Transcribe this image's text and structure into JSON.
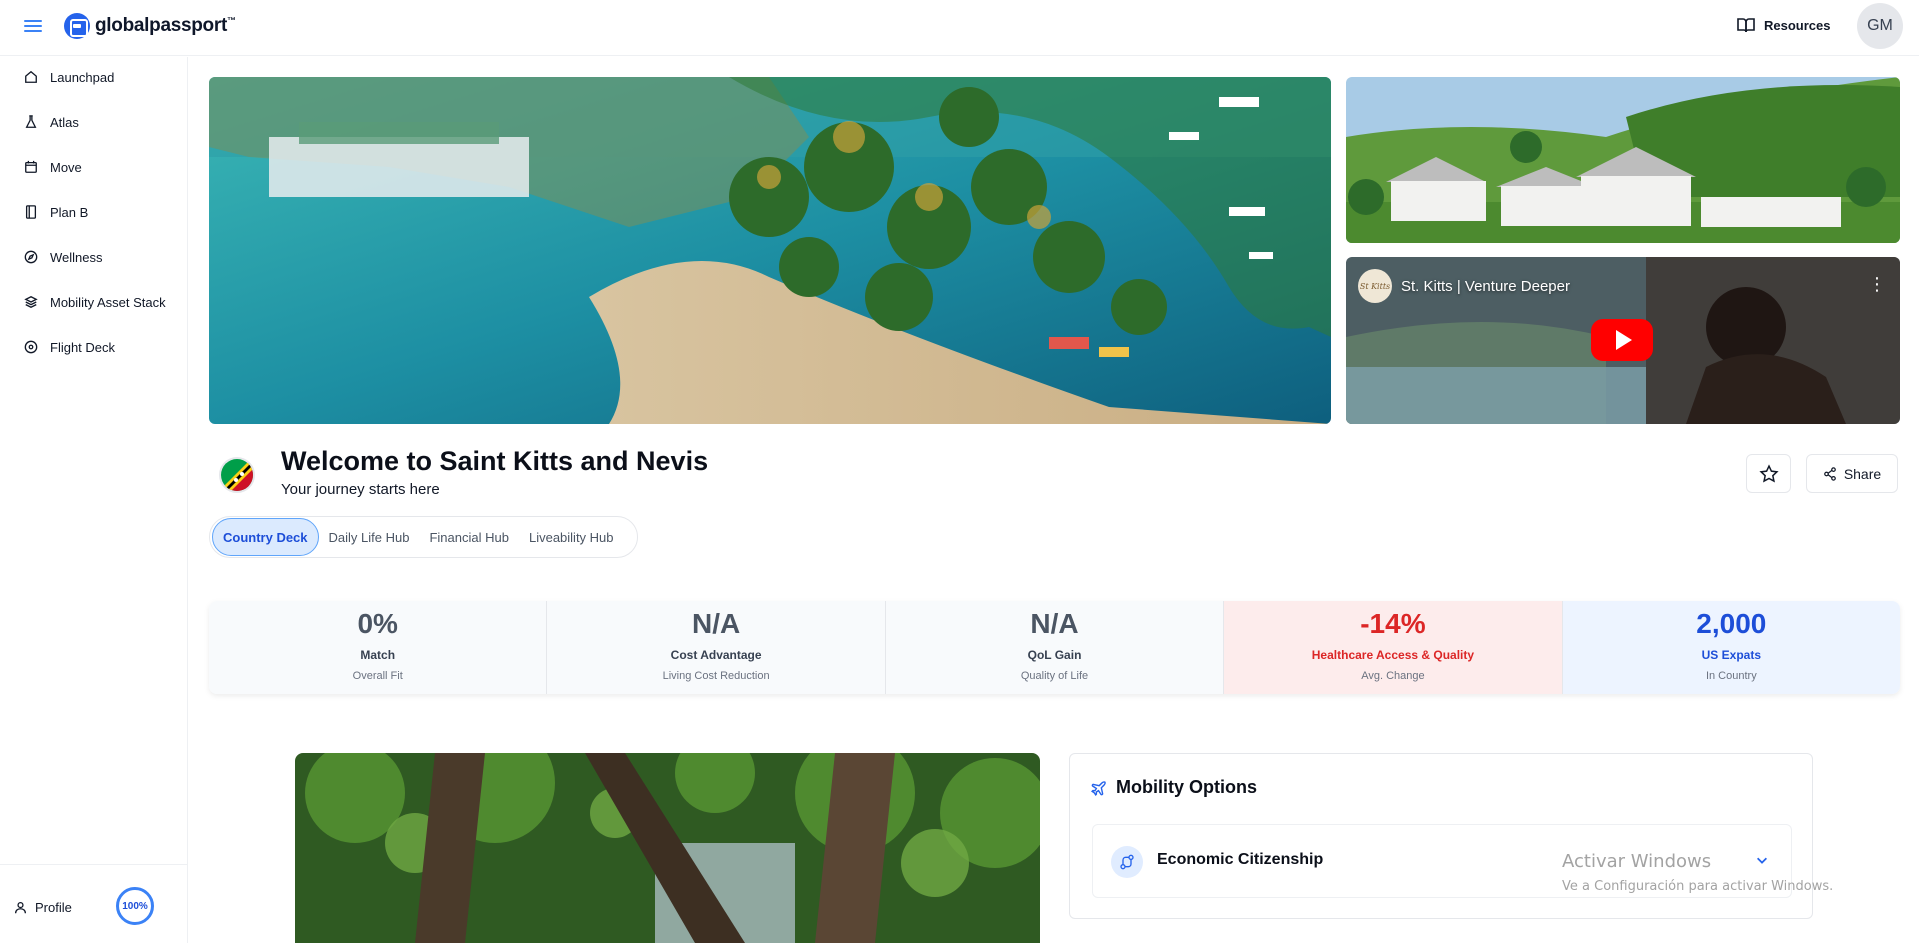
{
  "app": {
    "logo_text": "globalpassport",
    "logo_tm": "™",
    "resources_label": "Resources",
    "avatar_initials": "GM"
  },
  "sidebar": {
    "items": [
      {
        "label": "Launchpad",
        "icon": "home-icon"
      },
      {
        "label": "Atlas",
        "icon": "flask-icon"
      },
      {
        "label": "Move",
        "icon": "calendar-icon"
      },
      {
        "label": "Plan B",
        "icon": "book-icon"
      },
      {
        "label": "Wellness",
        "icon": "compass-icon"
      },
      {
        "label": "Mobility Asset Stack",
        "icon": "layers-icon"
      },
      {
        "label": "Flight Deck",
        "icon": "target-icon"
      }
    ],
    "profile_label": "Profile",
    "profile_completion": "100%"
  },
  "video": {
    "title": "St. Kitts | Venture Deeper",
    "channel_badge": "St Kitts"
  },
  "header": {
    "title": "Welcome to Saint Kitts and Nevis",
    "subtitle": "Your journey starts here",
    "share_label": "Share"
  },
  "tabs": [
    {
      "label": "Country Deck",
      "active": true
    },
    {
      "label": "Daily Life Hub",
      "active": false
    },
    {
      "label": "Financial Hub",
      "active": false
    },
    {
      "label": "Liveability Hub",
      "active": false
    }
  ],
  "stats": [
    {
      "value": "0%",
      "label": "Match",
      "sub": "Overall Fit",
      "tone": "neutral"
    },
    {
      "value": "N/A",
      "label": "Cost Advantage",
      "sub": "Living Cost Reduction",
      "tone": "neutral"
    },
    {
      "value": "N/A",
      "label": "QoL Gain",
      "sub": "Quality of Life",
      "tone": "neutral"
    },
    {
      "value": "-14%",
      "label": "Healthcare Access & Quality",
      "sub": "Avg. Change",
      "tone": "red"
    },
    {
      "value": "2,000",
      "label": "US Expats",
      "sub": "In Country",
      "tone": "blue"
    }
  ],
  "mobility": {
    "title": "Mobility Options",
    "option_label": "Economic Citizenship"
  },
  "watermark": {
    "title": "Activar Windows",
    "subtitle": "Ve a Configuración para activar Windows."
  },
  "colors": {
    "accent": "#2563eb",
    "negative": "#dc2626",
    "positive_blue": "#1d4ed8"
  }
}
